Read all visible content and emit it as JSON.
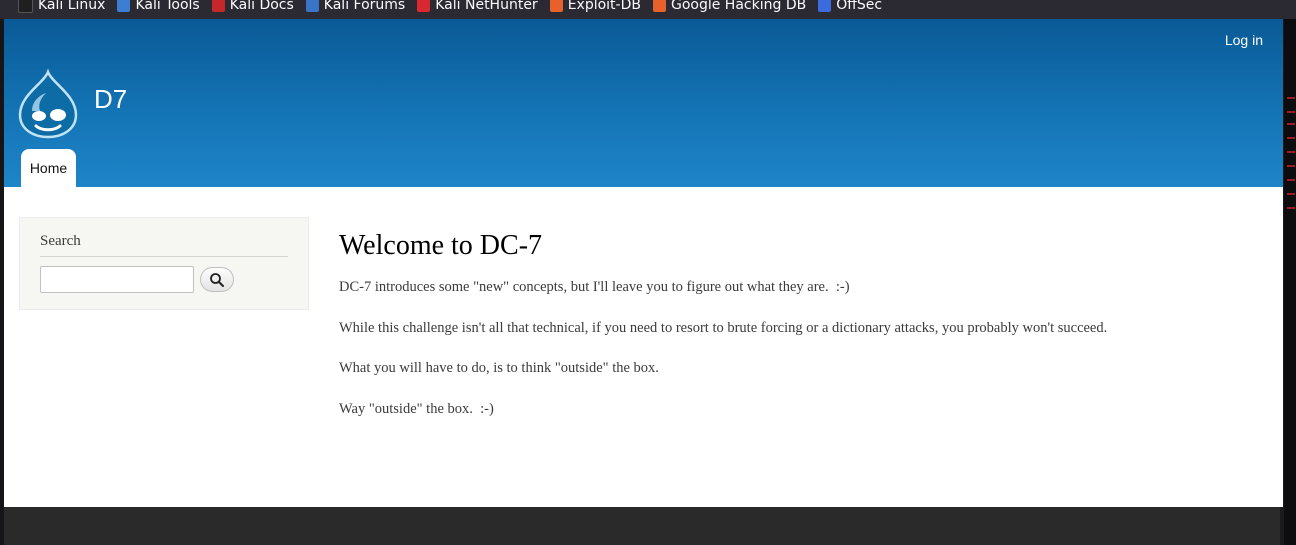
{
  "bookmarks": [
    {
      "label": "Kali Linux",
      "icon": "kali-dragon-icon"
    },
    {
      "label": "Kali Tools",
      "icon": "kali-tools-icon"
    },
    {
      "label": "Kali Docs",
      "icon": "kali-docs-icon"
    },
    {
      "label": "Kali Forums",
      "icon": "kali-forums-icon"
    },
    {
      "label": "Kali NetHunter",
      "icon": "kali-nethunter-icon"
    },
    {
      "label": "Exploit-DB",
      "icon": "exploit-db-icon"
    },
    {
      "label": "Google Hacking DB",
      "icon": "ghdb-icon"
    },
    {
      "label": "OffSec",
      "icon": "offsec-icon"
    }
  ],
  "header": {
    "login_label": "Log in",
    "site_name": "D7",
    "logo_icon": "drupal-drop-logo",
    "nav_tabs": [
      {
        "label": "Home",
        "active": true
      }
    ]
  },
  "sidebar": {
    "search": {
      "title": "Search",
      "input_value": "",
      "button_icon": "search-icon"
    }
  },
  "main": {
    "title": "Welcome to DC-7",
    "paragraphs": [
      "DC-7 introduces some \"new\" concepts, but I'll leave you to figure out what they are.  :-)",
      "While this challenge isn't all that technical, if you need to resort to brute forcing or a dictionary attacks, you probably won't succeed.",
      "What you will have to do, is to think \"outside\" the box.",
      "Way \"outside\" the box.  :-)"
    ]
  },
  "colors": {
    "header_top": "#0a5a96",
    "header_bottom": "#1e85c8",
    "bookmarks_bg": "#2b2a33",
    "sidebar_block_bg": "#f6f6f2",
    "footer_bg": "#2a2a2a"
  }
}
